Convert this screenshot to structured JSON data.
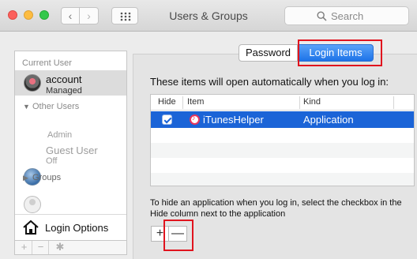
{
  "window": {
    "title": "Users & Groups",
    "search_placeholder": "Search"
  },
  "toolbar": {
    "back_icon": "‹",
    "forward_icon": "›"
  },
  "sidebar": {
    "current_user_header": "Current User",
    "current_user": {
      "name": "account",
      "role": "Managed"
    },
    "other_users_header": "Other Users",
    "other_users": [
      {
        "name": "",
        "role": "Admin"
      },
      {
        "name": "Guest User",
        "role": "Off"
      }
    ],
    "groups_label": "Groups",
    "login_options_label": "Login Options",
    "add_label": "+",
    "remove_label": "−"
  },
  "tabs": [
    {
      "label": "Password",
      "active": false
    },
    {
      "label": "Login Items",
      "active": true
    }
  ],
  "main": {
    "description": "These items will open automatically when you log in:",
    "columns": [
      "Hide",
      "Item",
      "Kind"
    ],
    "rows": [
      {
        "hide": true,
        "item": "iTunesHelper",
        "kind": "Application",
        "selected": true
      }
    ],
    "hint": "To hide an application when you log in, select the checkbox in the Hide  column next to the application",
    "add_label": "+",
    "remove_label": "—"
  },
  "colors": {
    "selection": "#1b64d7",
    "highlight_box": "#e0141e",
    "active_tab": "#1d73e8"
  }
}
